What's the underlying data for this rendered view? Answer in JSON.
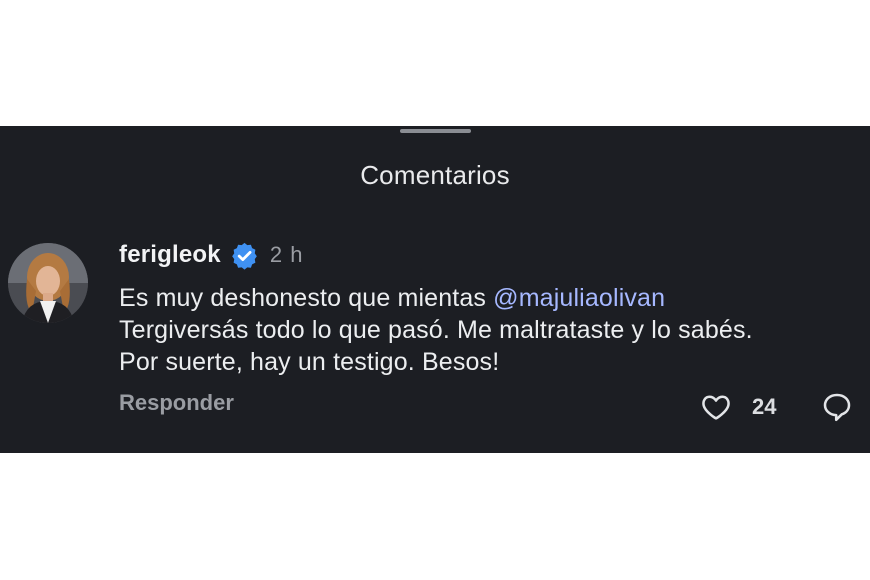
{
  "sheet": {
    "title": "Comentarios"
  },
  "comment": {
    "username": "ferigleok",
    "verified": true,
    "timestamp": "2 h",
    "text_line1_prefix": "Es muy deshonesto que mientas ",
    "mention_icon": "@",
    "mention": "majuliaolivan",
    "text_line2": "Tergiversás todo lo que pasó. Me maltrataste y lo sabés.",
    "text_line3": "Por suerte, hay un testigo. Besos!",
    "reply_label": "Responder",
    "like_count": "24"
  },
  "icons": {
    "verified": "verified-badge-icon",
    "like": "heart-icon",
    "reply": "comment-bubble-icon"
  },
  "colors": {
    "sheet_background": "#1c1e23",
    "mention": "#a6b8ff",
    "verified_badge": "#3f91f2",
    "secondary_text": "#9a9da3"
  }
}
